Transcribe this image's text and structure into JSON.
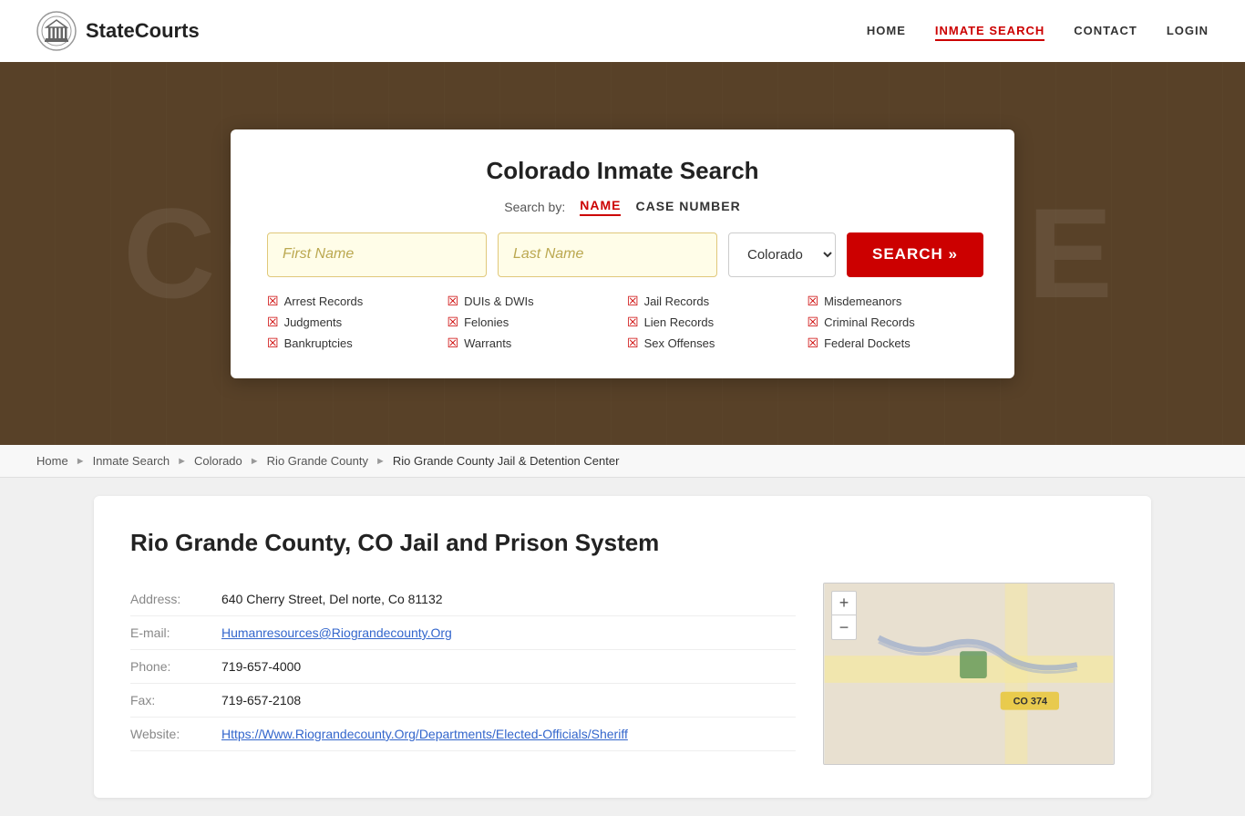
{
  "brand": {
    "name": "StateCourts",
    "logo_alt": "StateCourts logo"
  },
  "nav": {
    "links": [
      {
        "label": "HOME",
        "href": "#",
        "active": false
      },
      {
        "label": "INMATE SEARCH",
        "href": "#",
        "active": true
      },
      {
        "label": "CONTACT",
        "href": "#",
        "active": false
      },
      {
        "label": "LOGIN",
        "href": "#",
        "active": false
      }
    ]
  },
  "hero": {
    "word": "COURTHOUSE"
  },
  "search_card": {
    "title": "Colorado Inmate Search",
    "search_by_label": "Search by:",
    "tab_name": "NAME",
    "tab_case": "CASE NUMBER",
    "first_name_placeholder": "First Name",
    "last_name_placeholder": "Last Name",
    "state_default": "Colorado",
    "search_button": "SEARCH »",
    "checklist": [
      [
        "Arrest Records",
        "Judgments",
        "Bankruptcies"
      ],
      [
        "DUIs & DWIs",
        "Felonies",
        "Warrants"
      ],
      [
        "Jail Records",
        "Lien Records",
        "Sex Offenses"
      ],
      [
        "Misdemeanors",
        "Criminal Records",
        "Federal Dockets"
      ]
    ]
  },
  "breadcrumb": {
    "items": [
      {
        "label": "Home",
        "href": "#"
      },
      {
        "label": "Inmate Search",
        "href": "#"
      },
      {
        "label": "Colorado",
        "href": "#"
      },
      {
        "label": "Rio Grande County",
        "href": "#"
      },
      {
        "label": "Rio Grande County Jail & Detention Center",
        "href": "#",
        "current": true
      }
    ]
  },
  "content": {
    "title": "Rio Grande County, CO Jail and Prison System",
    "address_label": "Address:",
    "address_value": "640 Cherry Street, Del norte, Co 81132",
    "email_label": "E-mail:",
    "email_value": "Humanresources@Riograndecounty.Org",
    "phone_label": "Phone:",
    "phone_value": "719-657-4000",
    "fax_label": "Fax:",
    "fax_value": "719-657-2108",
    "website_label": "Website:",
    "website_value": "Https://Www.Riograndecounty.Org/Departments/Elected-Officials/Sheriff"
  },
  "map": {
    "plus": "+",
    "minus": "−"
  }
}
